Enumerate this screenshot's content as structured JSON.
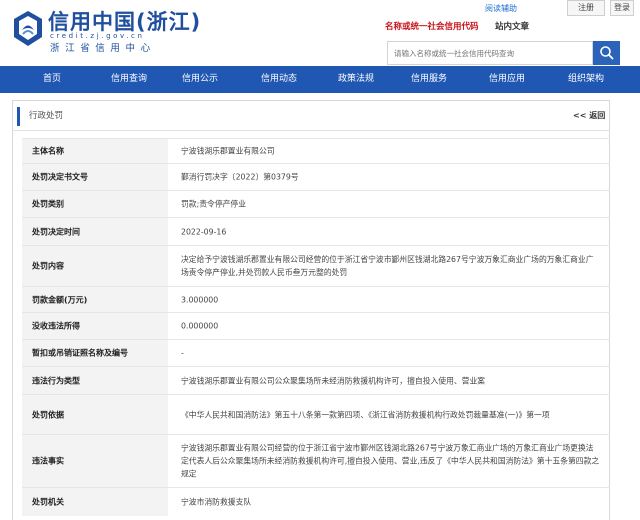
{
  "header": {
    "site_title": "信用中国(浙江)",
    "site_url": "credit.zj.gov.cn",
    "site_subtitle": "浙江省信用中心",
    "help_link": "阅读辅助",
    "register_label": "注册",
    "login_label": "登录",
    "search_tabs": [
      "名称或统一社会信用代码",
      "站内文章"
    ],
    "search_placeholder": "请输入名称或统一社会信用代码查询",
    "search_icon": "search-icon"
  },
  "nav": {
    "items": [
      "首页",
      "信用查询",
      "信用公示",
      "信用动态",
      "政策法规",
      "信用服务",
      "信用应用",
      "组织架构"
    ]
  },
  "panel": {
    "title": "行政处罚",
    "back_label": "<< 返回"
  },
  "details": [
    {
      "key": "主体名称",
      "value": "宁波钱湖乐郡置业有限公司"
    },
    {
      "key": "处罚决定书文号",
      "value": "鄞消行罚决字〔2022〕第0379号"
    },
    {
      "key": "处罚类别",
      "value": "罚款;责令停产停业"
    },
    {
      "key": "处罚决定时间",
      "value": "2022-09-16"
    },
    {
      "key": "处罚内容",
      "value": "决定给予宁波钱湖乐郡置业有限公司经营的位于浙江省宁波市鄞州区钱湖北路267号宁波万象汇商业广场的万象汇商业广场责令停产停业,并处罚款人民币叁万元整的处罚"
    },
    {
      "key": "罚款金额(万元)",
      "value": "3.000000"
    },
    {
      "key": "没收违法所得",
      "value": "0.000000"
    },
    {
      "key": "暂扣或吊销证照名称及编号",
      "value": "-"
    },
    {
      "key": "违法行为类型",
      "value": "宁波钱湖乐郡置业有限公司公众聚集场所未经消防救援机构许可，擅自投入使用、营业案"
    },
    {
      "key": "处罚依据",
      "value": "《中华人民共和国消防法》第五十八条第一款第四项、《浙江省消防救援机构行政处罚裁量基准(一)》第一项"
    },
    {
      "key": "违法事实",
      "value": "宁波钱湖乐郡置业有限公司经营的位于浙江省宁波市鄞州区钱湖北路267号宁波万象汇商业广场的万象汇商业广场更换法定代表人后公众聚集场所未经消防救援机构许可,擅自投入使用、营业,违反了《中华人民共和国消防法》第十五条第四款之规定"
    },
    {
      "key": "处罚机关",
      "value": "宁波市消防救援支队"
    }
  ]
}
